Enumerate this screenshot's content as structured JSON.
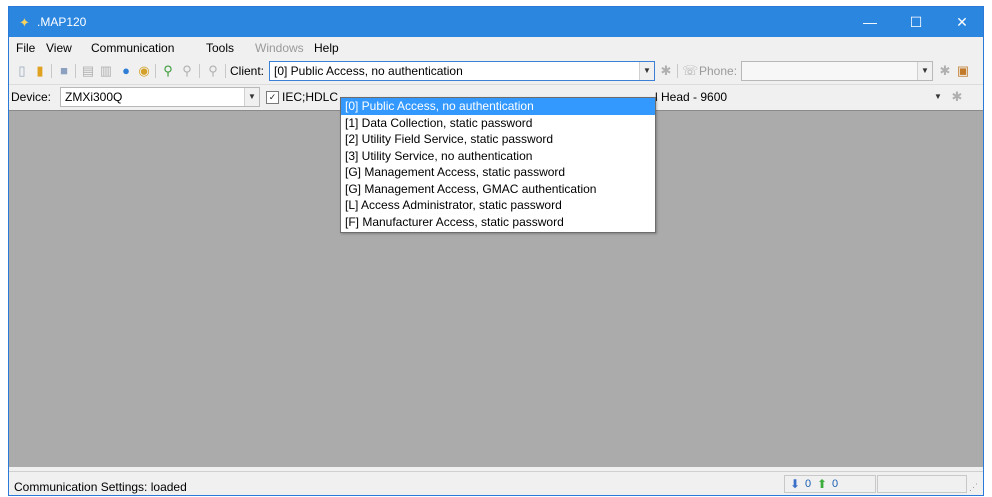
{
  "window": {
    "title": ".MAP120",
    "minimize": "—",
    "maximize": "☐",
    "close": "✕"
  },
  "menu": {
    "file": "File",
    "view": "View",
    "communication": "Communication",
    "tools": "Tools",
    "windows": "Windows",
    "help": "Help"
  },
  "toolbar": {
    "client_label": "Client:",
    "client_value": "[0] Public Access, no authentication",
    "phone_label": "Phone:",
    "phone_value": ""
  },
  "device_bar": {
    "device_label": "Device:",
    "device_value": "ZMXi300Q",
    "protocol_label": "IEC;HDLC",
    "interface_value": "l Head - 9600"
  },
  "client_dropdown": {
    "options": [
      "[0] Public Access, no authentication",
      "[1] Data Collection, static password",
      "[2] Utility Field Service, static password",
      "[3] Utility Service, no authentication",
      "[G] Management Access, static password",
      "[G] Management Access, GMAC authentication",
      "[L] Access Administrator, static password",
      "[F] Manufacturer Access, static password"
    ],
    "selected_index": 0
  },
  "status": {
    "text": "Communication Settings: loaded",
    "received_count": "0",
    "sent_count": "0"
  },
  "colors": {
    "titlebar": "#2b86e0",
    "selection": "#3399ff",
    "workspace": "#ababab"
  }
}
